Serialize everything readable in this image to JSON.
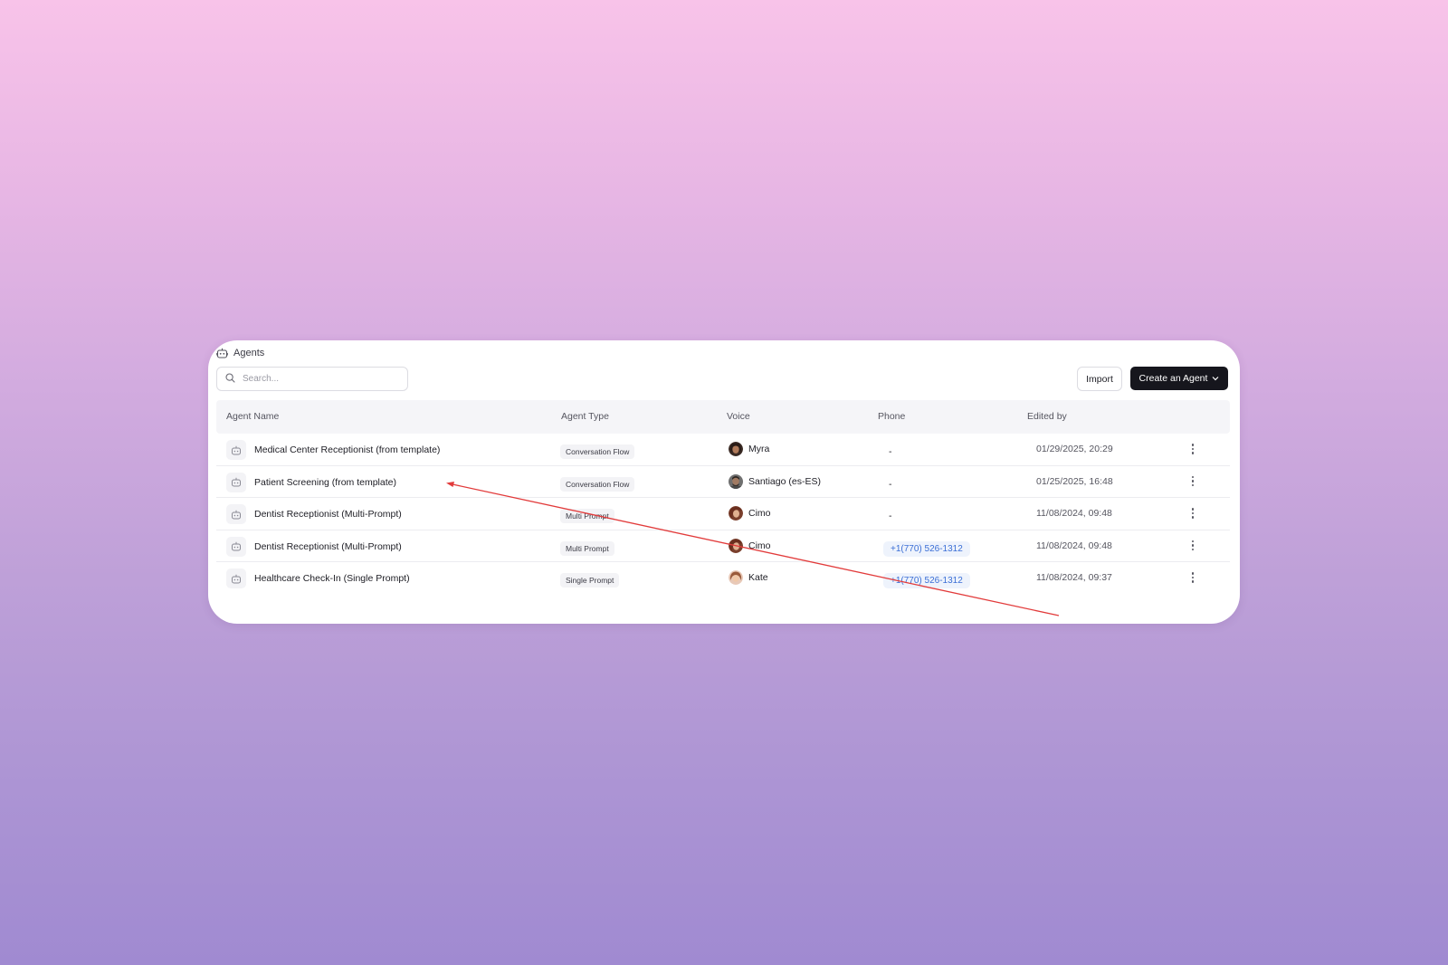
{
  "breadcrumb": {
    "icon": "robot-icon",
    "label": "Agents"
  },
  "search": {
    "placeholder": "Search...",
    "value": "",
    "icon": "search-icon"
  },
  "toolbar": {
    "import_label": "Import",
    "create_label": "Create an Agent",
    "create_icon": "chevron-down-icon"
  },
  "table": {
    "headers": [
      "Agent Name",
      "Agent Type",
      "Voice",
      "Phone",
      "Edited by"
    ],
    "rows": [
      {
        "name": "Medical Center Receptionist (from template)",
        "type": "Conversation Flow",
        "voice": "Myra",
        "phone": "-",
        "edited": "01/29/2025, 20:29"
      },
      {
        "name": "Patient Screening (from template)",
        "type": "Conversation Flow",
        "voice": "Santiago (es-ES)",
        "phone": "-",
        "edited": "01/25/2025, 16:48"
      },
      {
        "name": "Dentist Receptionist (Multi-Prompt)",
        "type": "Multi Prompt",
        "voice": "Cimo",
        "phone": "-",
        "edited": "11/08/2024, 09:48"
      },
      {
        "name": "Dentist Receptionist (Multi-Prompt)",
        "type": "Multi Prompt",
        "voice": "Cimo",
        "phone": "+1(770) 526-1312",
        "edited": "11/08/2024, 09:48"
      },
      {
        "name": "Healthcare Check-In (Single Prompt)",
        "type": "Single Prompt",
        "voice": "Kate",
        "phone": "+1(770) 526-1312",
        "edited": "11/08/2024, 09:37"
      }
    ]
  },
  "colors": {
    "primary_button": "#16161d",
    "phone_link": "#3b6fd6",
    "annotation_arrow": "#e23b3b"
  }
}
